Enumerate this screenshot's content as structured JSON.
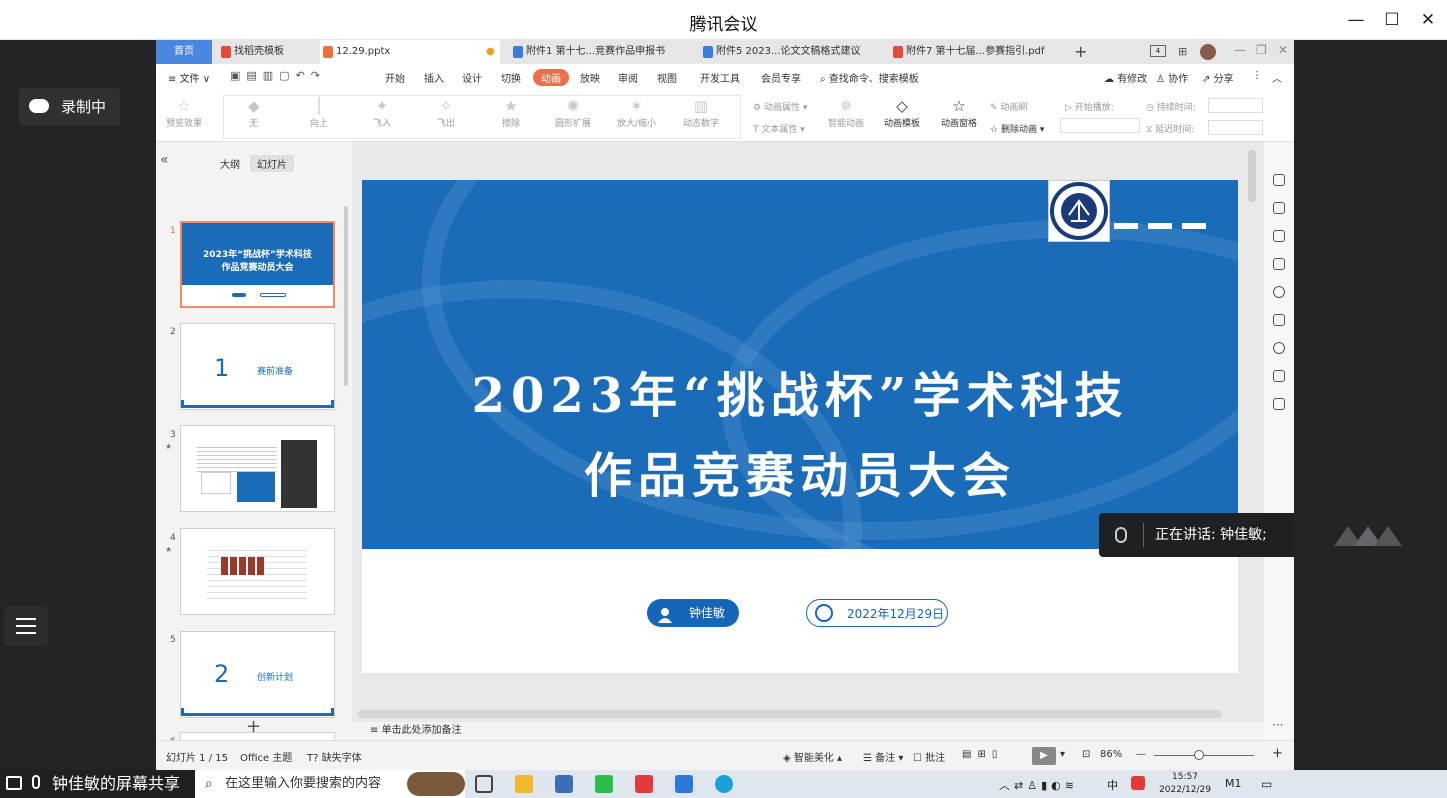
{
  "window": {
    "title": "腾讯会议"
  },
  "meeting": {
    "recording_label": "录制中",
    "speaker_label": "正在讲话: 钟佳敏;",
    "share_label": "钟佳敏的屏幕共享"
  },
  "wps": {
    "tabs": [
      {
        "label": "首页"
      },
      {
        "label": "找稻壳模板"
      },
      {
        "label": "12.29.pptx"
      },
      {
        "label": "附件1 第十七...竞赛作品申报书"
      },
      {
        "label": "附件5 2023...论文文稿格式建议"
      },
      {
        "label": "附件7 第十七届...参赛指引.pdf"
      }
    ],
    "menus": {
      "file": "文件",
      "start": "开始",
      "insert": "插入",
      "design": "设计",
      "transition": "切换",
      "animation": "动画",
      "slideshow": "放映",
      "review": "审阅",
      "view": "视图",
      "developer": "开发工具",
      "member": "会员专享",
      "search": "查找命令、搜索模板",
      "edit_status": "有修改",
      "collab": "协作",
      "share": "分享"
    },
    "ribbon": {
      "preview": "预览效果",
      "none": "无",
      "up": "向上",
      "flyin": "飞入",
      "flyout": "飞出",
      "erase": "擦除",
      "expand": "圆形扩展",
      "zoom": "放大/缩小",
      "numbers": "动态数字",
      "anim_prop": "动画属性",
      "text_prop": "文本属性",
      "smart_anim": "智能动画",
      "anim_template": "动画模板",
      "anim_pane": "动画窗格",
      "anim_brush": "动画刷",
      "delete_anim": "删除动画",
      "start_play": "开始播放:",
      "duration": "持续时间:",
      "delay": "延迟时间:"
    },
    "panel": {
      "outline": "大纲",
      "slides": "幻灯片",
      "thumb2_title": "赛前准备",
      "thumb5_title": "创新计划",
      "thumb2_num": "1",
      "thumb5_num": "2",
      "add": "+"
    },
    "slide": {
      "title_line1": "2023年“挑战杯”学术科技",
      "title_line2": "作品竞赛动员大会",
      "presenter": "钟佳敏",
      "date": "2022年12月29日"
    },
    "notes_placeholder": "单击此处添加备注",
    "status": {
      "slide_count": "幻灯片 1 / 15",
      "theme": "Office 主题",
      "missing_font": "缺失字体",
      "smart_beautify": "智能美化",
      "notes": "备注",
      "comments": "批注",
      "zoom": "86%"
    }
  },
  "taskbar": {
    "search_placeholder": "在这里输入你要搜索的内容",
    "time": "15:57",
    "date": "2022/12/29",
    "ime": "中"
  }
}
